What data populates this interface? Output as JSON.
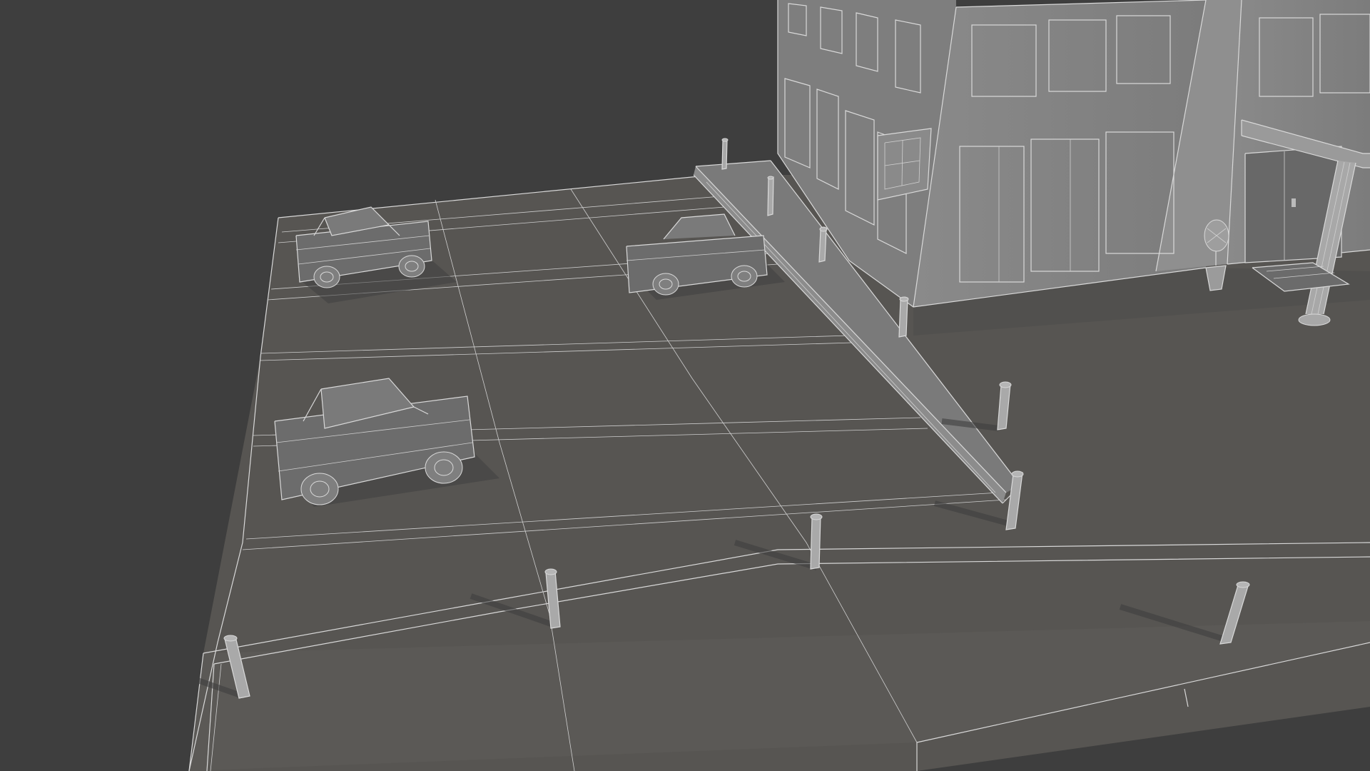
{
  "viewport": {
    "mode": "wireframe-overlay",
    "background_color": "#3e3e3e",
    "ground_color": "#575552",
    "model_color": "#6f6f6f",
    "wire_color": "#d9d9d9"
  },
  "scene": {
    "objects": [
      {
        "name": "office-building",
        "icon": "building-icon"
      },
      {
        "name": "entrance-canopy",
        "icon": "canopy-icon"
      },
      {
        "name": "potted-plant",
        "icon": "plant-icon"
      },
      {
        "name": "entrance-mat",
        "icon": "mat-icon"
      },
      {
        "name": "parking-lot-ground",
        "icon": "ground-icon"
      },
      {
        "name": "curb",
        "icon": "curb-icon"
      },
      {
        "name": "car-1",
        "icon": "car-icon"
      },
      {
        "name": "car-2",
        "icon": "car-icon"
      },
      {
        "name": "car-3",
        "icon": "car-icon"
      },
      {
        "name": "bollards",
        "icon": "bollard-icon",
        "count": 10
      }
    ]
  }
}
